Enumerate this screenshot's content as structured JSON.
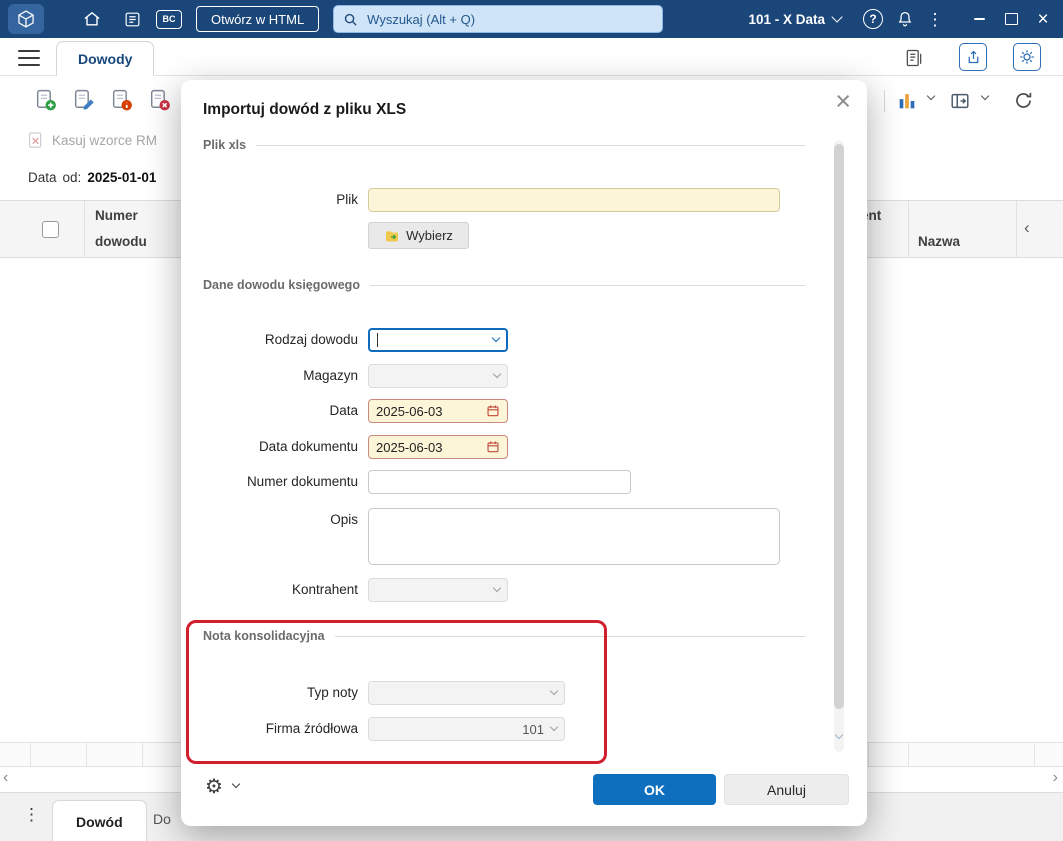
{
  "colors": {
    "topbar_bg": "#1b4679",
    "accent_blue": "#0f6cbd",
    "annotation_red": "#d02030",
    "cream_field": "#fdf5d8"
  },
  "icons": {
    "kebab": "⋮",
    "close_x": "×",
    "chevron_left": "‹",
    "chevron_right": "›",
    "question": "?"
  },
  "topbar": {
    "bc_badge": "BC",
    "open_html": "Otwórz w HTML",
    "search_placeholder": "Wyszukaj (Alt + Q)",
    "company": "101 - X Data"
  },
  "tabstrip": {
    "active_tab": "Dowody"
  },
  "toolbar": {
    "kasuj_wzorce": "Kasuj wzorce RM"
  },
  "filter": {
    "label": "Data",
    "od": "od:",
    "value": "2025-01-01"
  },
  "table": {
    "col_numer_1": "Numer",
    "col_numer_2": "dowodu",
    "col_kontrahent_partial": "ent",
    "col_nazwa": "Nazwa"
  },
  "bottombar": {
    "active_tab": "Dowód",
    "partial_tab": "Do"
  },
  "modal": {
    "title": "Importuj dowód z pliku  XLS",
    "section_plik": "Plik xls",
    "section_dane": "Dane dowodu księgowego",
    "section_nota": "Nota  konsolidacyjna",
    "plik_label": "Plik",
    "wybierz": "Wybierz",
    "rodzaj_label": "Rodzaj dowodu",
    "magazyn_label": "Magazyn",
    "data_label": "Data",
    "data_value": "2025-06-03",
    "data_dok_label": "Data dokumentu",
    "data_dok_value": "2025-06-03",
    "numer_label": "Numer dokumentu",
    "opis_label": "Opis",
    "kontrahent_label": "Kontrahent",
    "typ_noty_label": "Typ noty",
    "firma_label": "Firma źródłowa",
    "firma_value": "101",
    "ok": "OK",
    "anuluj": "Anuluj"
  }
}
